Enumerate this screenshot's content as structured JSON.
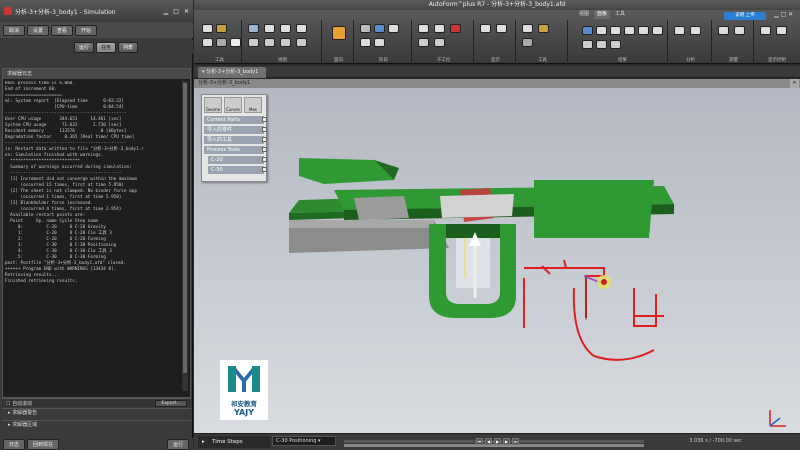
{
  "left_window": {
    "title": "分析-3+分析-3_body1 - Simulation",
    "buttons": [
      "取消",
      "设置",
      "查看",
      "开始"
    ],
    "modules": [
      "运行",
      "任务",
      "列表"
    ],
    "panel_title": "求解器日志",
    "sections": [
      "求解器警告",
      "求解器区域"
    ],
    "bottom_buttons": [
      "日志",
      "回到现在",
      "运行"
    ],
    "export": "Export..."
  },
  "log_lines": [
    "Real process time is 6.060.",
    "",
    "End of increment 60.",
    "======================",
    "",
    "ml: System report  [Elapsed time      0:02:32]",
    "                   [CPU-time          0:04:54]",
    "-----------------------------------------------",
    "User CPU usage       344.653     14.461 [sec]",
    "System CPU usage      71.632      2.730 [sec]",
    "Resident memory      113576          0 [kBytes]",
    "Degradation factor     0.365 [Real time/ CPU time]",
    "-----------------------------------------------",
    "",
    "in: Restart data written to file \"分析-3+分析-3_body1.r",
    "on: Simulation finished with warnings.",
    "  ***************************",
    "",
    "  Summary of warnings occurred during simulation:",
    "  -------------------------------------------",
    "  [1] Increment did not converge within the maximum",
    "      (occurred 15 times, first at time 5.950)",
    "  [2] The sheet is not clamped. No binder force app",
    "      (occurred 1 times, first at time 5.950)",
    "  [3] Blankholder force increased.",
    "      (occurred 4 times, first at time 2.954)",
    "",
    "  Available restart points are:",
    "  Point     Op. name Cycle Step name",
    "     0:         C-20     0 C-20 Gravity",
    "     1:         C-20     0 C-20 Clo 工具 3",
    "     2:         C-20     0 C-20 Forming",
    "     3:         C-30     0 C-30 Positioning",
    "     4:         C-30     0 C-30 Clo 工具 3",
    "     5:         C-30     0 C-30 Forming",
    "post: Postfile \"分析-3+分析-3_body1.afd\" closed.",
    "",
    "++++++ Program END with WARNINGS [13434 0].",
    "",
    "Retrieving results...",
    "Finished retrieving results."
  ],
  "app_title": "AutoForm^plus R7 - 分析-3+分析-3_body1.afd",
  "ribbon": {
    "groups": [
      "工具",
      "视图",
      "面向",
      "阶段",
      "子工位",
      "显示",
      "工具",
      "结果",
      "分析",
      "测量",
      "显示控制"
    ],
    "tabs": [
      "视图",
      "面板",
      "工具"
    ],
    "top_right": "说明 上传"
  },
  "document": {
    "tab": "分析-3+分析-3_body1",
    "header": "分析-3+分析-3_body1"
  },
  "tree": {
    "tabs": [
      "Geome",
      "Curves",
      "Mes"
    ],
    "rows": [
      "Current Parts",
      "导入的零件",
      "导入的工具",
      "Process Tools",
      "C-20",
      "C-30"
    ]
  },
  "logo": {
    "cn": "祁安教育",
    "en": "YAJY"
  },
  "timeline": {
    "label": "Time Steps",
    "position": "C-30 Positioning",
    "info": "3.036 s / -700.00 sec"
  }
}
